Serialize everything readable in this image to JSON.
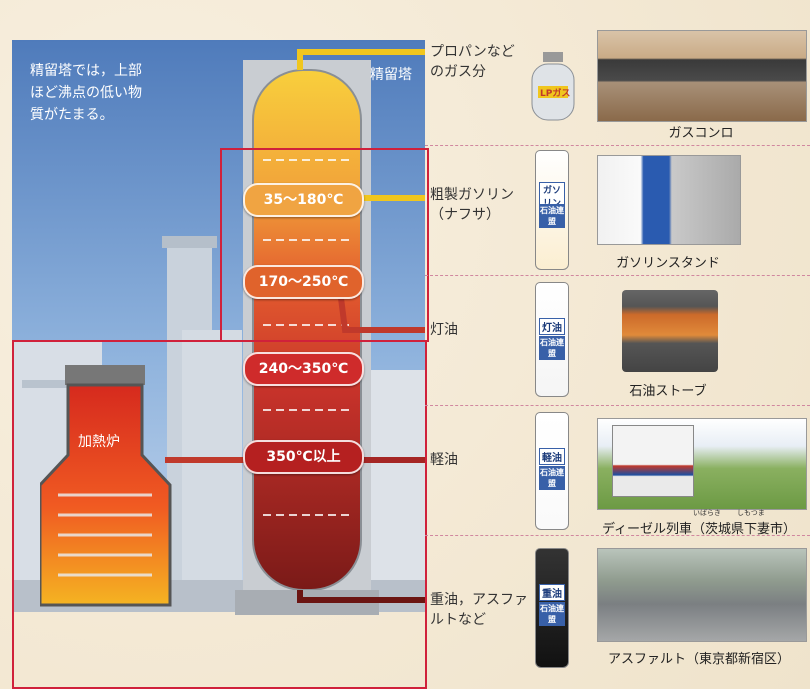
{
  "intro_note": [
    "精留塔では，上部",
    "ほど沸点の低い物",
    "質がたまる。"
  ],
  "tower_label": "精留塔",
  "furnace_label": "加熱炉",
  "temperatures": [
    "35〜180℃",
    "170〜250℃",
    "240〜350℃",
    "350℃以上"
  ],
  "fractions": [
    {
      "name": [
        "プロパンなど",
        "のガス分"
      ],
      "bottle": "LPガス",
      "use": "ガスコンロ"
    },
    {
      "name": [
        "粗製ガソリン",
        "（ナフサ）"
      ],
      "bottle": "ガソリン",
      "use": "ガソリンスタンド"
    },
    {
      "name": [
        "灯油"
      ],
      "bottle": "灯油",
      "use": "石油ストーブ"
    },
    {
      "name": [
        "軽油"
      ],
      "bottle": "軽油",
      "use": "ディーゼル列車（茨城県下妻市）",
      "ruby": [
        "いばらき",
        "しもつま"
      ]
    },
    {
      "name": [
        "重油，アスファ",
        "ルトなど"
      ],
      "bottle": "重油",
      "use": "アスファルト（東京都新宿区）"
    }
  ],
  "bottle_sub": "石油連盟",
  "colors": {
    "sky": "#5b86c3",
    "frame": "#d0213b",
    "pipe_gas": "#f0c61e",
    "pipe_other": "#c0392b",
    "dash": "#d0879f"
  }
}
